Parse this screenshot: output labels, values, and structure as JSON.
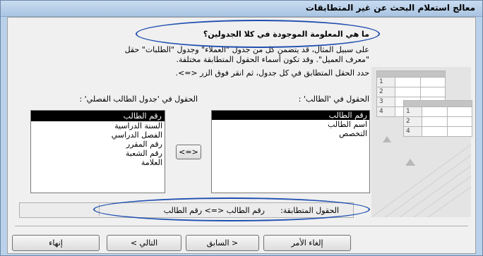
{
  "window": {
    "title": "معالج استعلام البحث عن غير المتطابقات"
  },
  "question": "ما هي المعلومة الموجودة في كلا الجدولين؟",
  "description": "على سبيل المثال، قد يتضمن كل من جدول \"العملاء\" وجدول \"الطلبات\" حقل \"معرف العميل\". وقد تكون أسماء الحقول المتطابقة مختلفة.",
  "instruction": "حدد الحقل المتطابق في كل جدول، ثم انقر فوق الزر <=>.",
  "left_list": {
    "label": "الحقول في 'الطالب' :",
    "items": [
      "رقم الطالب",
      "اسم الطالب",
      "التخصص"
    ]
  },
  "right_list": {
    "label": "الحقول في 'جدول الطالب الفصلي' :",
    "items": [
      "رقم الطالب",
      "السنة الدراسية",
      "الفصل الدراسي",
      "رقم المقرر",
      "رقم الشعبة",
      "العلامة"
    ]
  },
  "match_button": "<=>",
  "matching": {
    "label": "الحقول المتطابقة:",
    "value": "رقم الطالب <=> رقم الطالب"
  },
  "decoration": {
    "table1_rows": [
      "1",
      "2",
      "3",
      "4"
    ],
    "table2_rows": [
      "1",
      "2",
      "4"
    ]
  },
  "buttons": {
    "cancel": "إلغاء الأمر",
    "back": "< السابق",
    "next": "التالي >",
    "finish": "إنهاء"
  },
  "colors": {
    "oval": "#1f4fb0",
    "selection": "#000000"
  }
}
